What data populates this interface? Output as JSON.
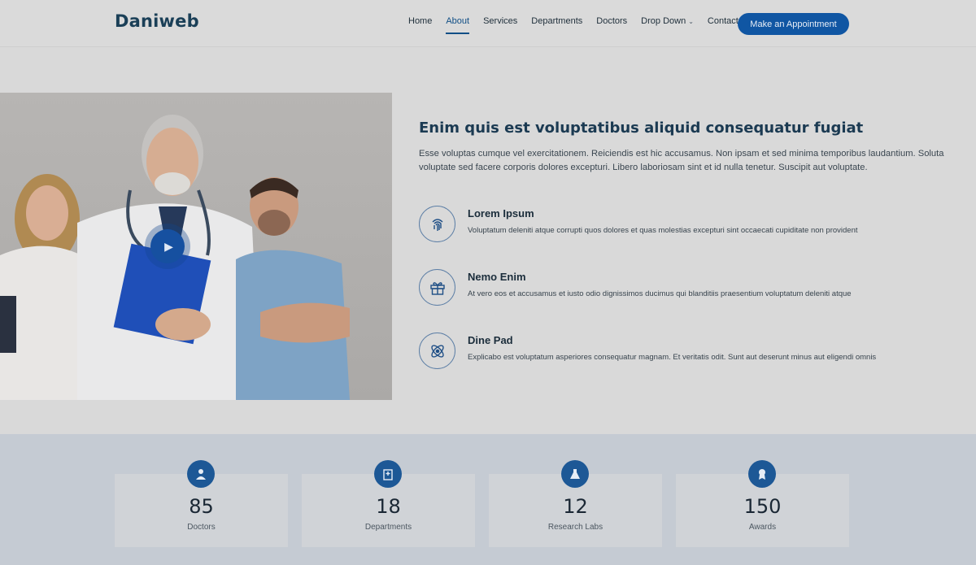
{
  "header": {
    "logo": "Daniweb",
    "nav": [
      {
        "label": "Home"
      },
      {
        "label": "About"
      },
      {
        "label": "Services"
      },
      {
        "label": "Departments"
      },
      {
        "label": "Doctors"
      },
      {
        "label": "Drop Down"
      },
      {
        "label": "Contact"
      }
    ],
    "active_nav": "About",
    "cta_label": "Make an Appointment"
  },
  "about": {
    "title": "Enim quis est voluptatibus aliquid consequatur fugiat",
    "description": "Esse voluptas cumque vel exercitationem. Reiciendis est hic accusamus. Non ipsam et sed minima temporibus laudantium. Soluta voluptate sed facere corporis dolores excepturi. Libero laboriosam sint et id nulla tenetur. Suscipit aut voluptate.",
    "features": [
      {
        "icon": "fingerprint-icon",
        "title": "Lorem Ipsum",
        "text": "Voluptatum deleniti atque corrupti quos dolores et quas molestias excepturi sint occaecati cupiditate non provident"
      },
      {
        "icon": "gift-icon",
        "title": "Nemo Enim",
        "text": "At vero eos et accusamus et iusto odio dignissimos ducimus qui blanditiis praesentium voluptatum deleniti atque"
      },
      {
        "icon": "atom-icon",
        "title": "Dine Pad",
        "text": "Explicabo est voluptatum asperiores consequatur magnam. Et veritatis odit. Sunt aut deserunt minus aut eligendi omnis"
      }
    ]
  },
  "stats": [
    {
      "icon": "doctor-icon",
      "value": "85",
      "label": "Doctors"
    },
    {
      "icon": "hospital-icon",
      "value": "18",
      "label": "Departments"
    },
    {
      "icon": "flask-icon",
      "value": "12",
      "label": "Research Labs"
    },
    {
      "icon": "award-icon",
      "value": "150",
      "label": "Awards"
    }
  ],
  "colors": {
    "brand": "#1a3f57",
    "accent": "#1056a3",
    "stats_band": "#c5cbd3"
  }
}
